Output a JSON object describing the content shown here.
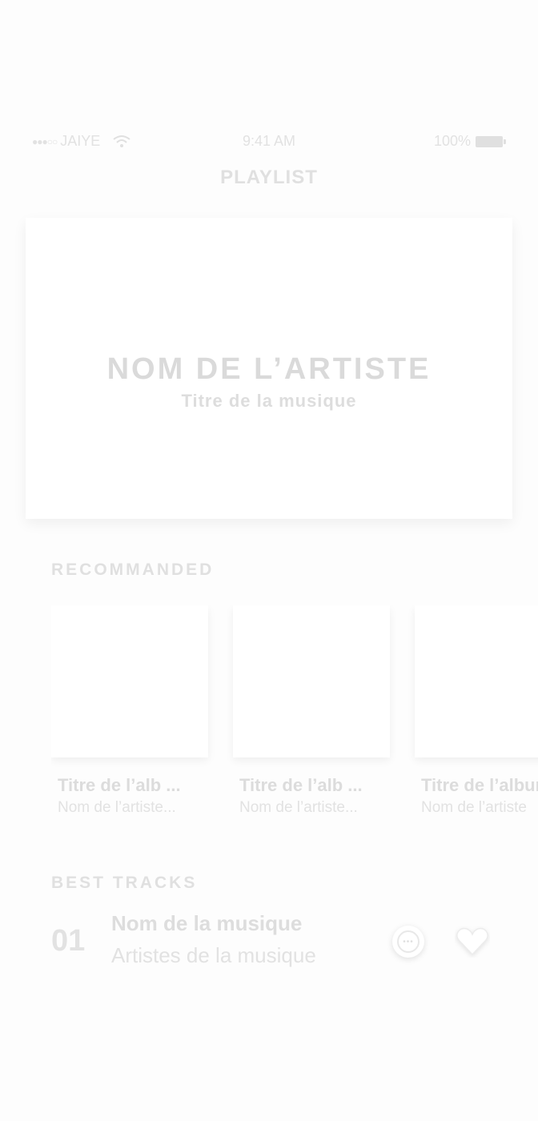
{
  "status_bar": {
    "signal": "●●●○○",
    "carrier": "JAIYE",
    "time": "9:41 AM",
    "battery": "100%"
  },
  "nav": {
    "title": "PLAYLIST"
  },
  "hero": {
    "artist": "NOM DE L’ARTISTE",
    "track": "Titre de la musique"
  },
  "recommended": {
    "title": "RECOMMANDED",
    "cards": [
      {
        "title": "Titre de l’alb ...",
        "artist": "Nom de l’artiste..."
      },
      {
        "title": "Titre de l’alb ...",
        "artist": "Nom de l’artiste..."
      },
      {
        "title": "Titre de l’album",
        "artist": "Nom de l’artiste"
      }
    ]
  },
  "best_tracks": {
    "title": "BEST TRACKS",
    "tracks": [
      {
        "number": "01",
        "name": "Nom de la musique",
        "artists": "Artistes de la musique",
        "more_icon": "more-options-icon",
        "heart_icon": "heart-icon"
      }
    ]
  },
  "colors": {
    "background": "#fdfdfd",
    "text": "#dcdcdc",
    "card": "#ffffff"
  }
}
